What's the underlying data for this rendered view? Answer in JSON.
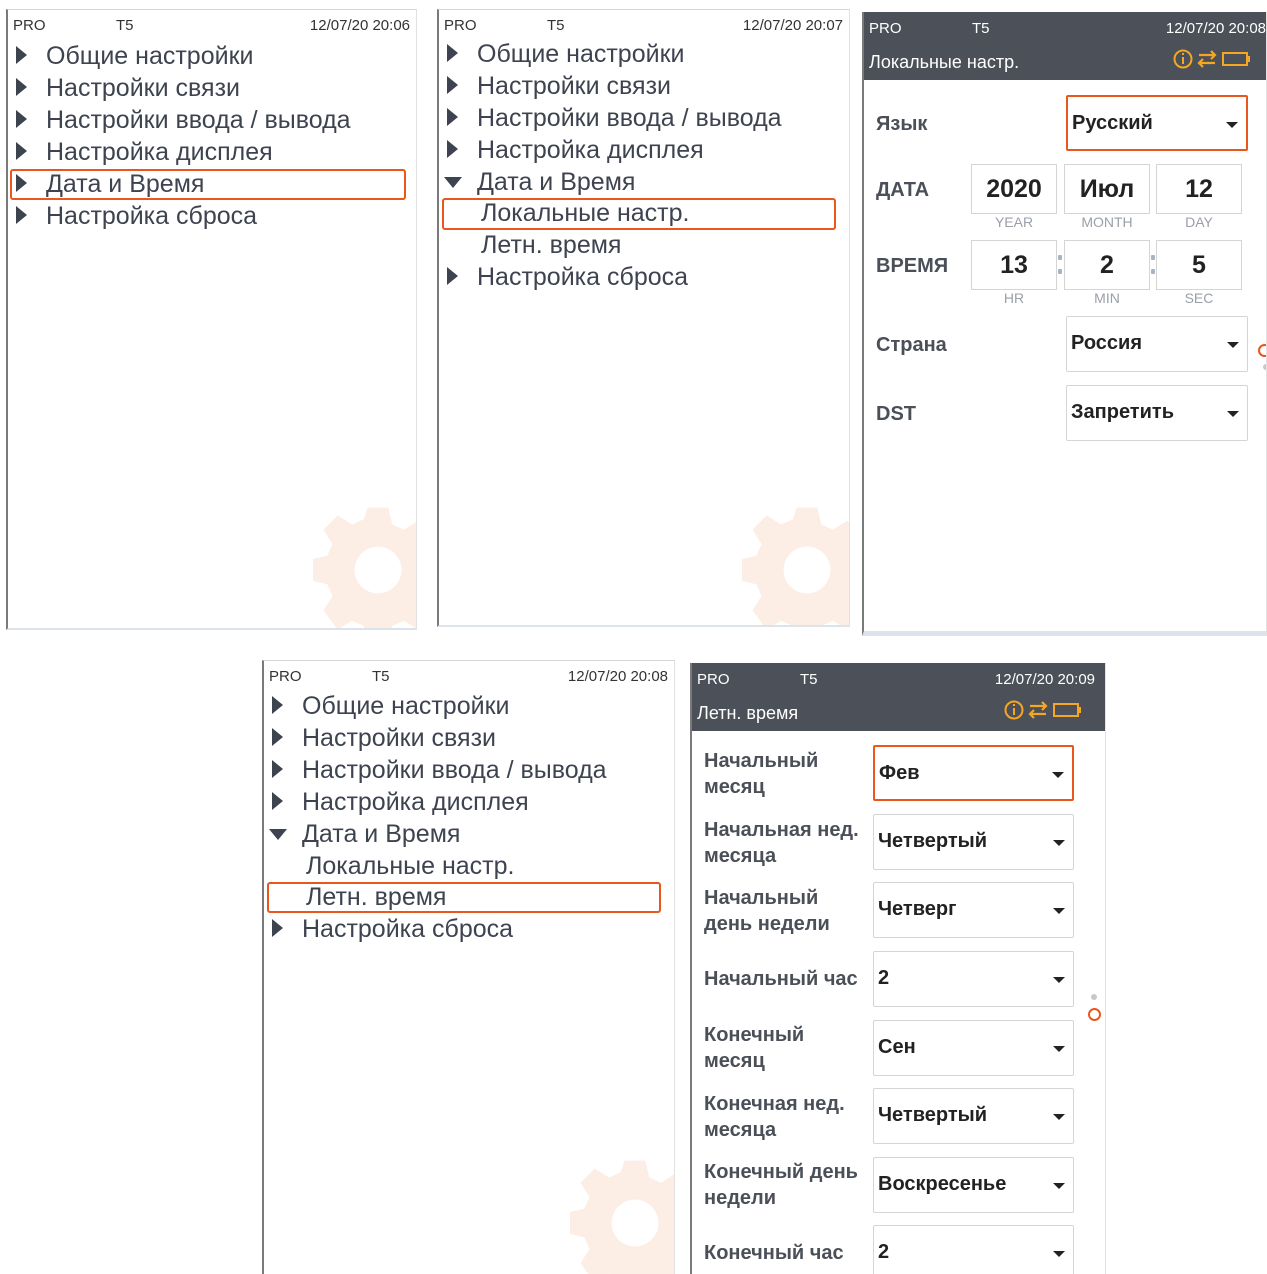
{
  "menu_items": {
    "general": "Общие настройки",
    "comm": "Настройки связи",
    "io": "Настройки ввода / вывода",
    "display": "Настройка дисплея",
    "datetime": "Дата и Время",
    "local": "Локальные настр.",
    "dst": "Летн. время",
    "reset": "Настройка сброса"
  },
  "status": {
    "pro": "PRO",
    "model": "T5"
  },
  "panel1": {
    "datetime": "12/07/20 20:06"
  },
  "panel2": {
    "datetime": "12/07/20 20:07"
  },
  "panel4": {
    "datetime": "12/07/20 20:08"
  },
  "panel3": {
    "datetime": "12/07/20 20:08",
    "title": "Локальные настр.",
    "language_label": "Язык",
    "language_value": "Русский",
    "date_label": "ДАТА",
    "year": "2020",
    "month": "Июл",
    "day": "12",
    "year_cap": "YEAR",
    "month_cap": "MONTH",
    "day_cap": "DAY",
    "time_label": "ВРЕМЯ",
    "hour": "13",
    "min": "2",
    "sec": "5",
    "hour_cap": "HR",
    "min_cap": "MIN",
    "sec_cap": "SEC",
    "country_label": "Страна",
    "country_value": "Россия",
    "dst_label": "DST",
    "dst_value": "Запретить"
  },
  "panel5": {
    "datetime": "12/07/20 20:09",
    "title": "Летн. время",
    "rows": [
      {
        "l1": "Начальный",
        "l2": "месяц",
        "value": "Фев"
      },
      {
        "l1": "Начальная нед.",
        "l2": "месяца",
        "value": "Четвертый"
      },
      {
        "l1": "Начальный",
        "l2": "день недели",
        "value": "Четверг"
      },
      {
        "l1": "Начальный час",
        "l2": "",
        "value": "2"
      },
      {
        "l1": "Конечный",
        "l2": "месяц",
        "value": "Сен"
      },
      {
        "l1": "Конечная нед.",
        "l2": "месяца",
        "value": "Четвертый"
      },
      {
        "l1": "Конечный день",
        "l2": "недели",
        "value": "Воскресенье"
      },
      {
        "l1": "Конечный час",
        "l2": "",
        "value": "2"
      }
    ]
  },
  "colors": {
    "accent": "#e8571c",
    "header": "#4b5059",
    "menu_text": "#3e4350",
    "gear": "#fdeee5"
  },
  "icons": [
    "info-icon",
    "transfer-icon",
    "battery-icon",
    "gear-icon",
    "caret-right-icon",
    "caret-down-icon",
    "dropdown-caret-icon"
  ]
}
